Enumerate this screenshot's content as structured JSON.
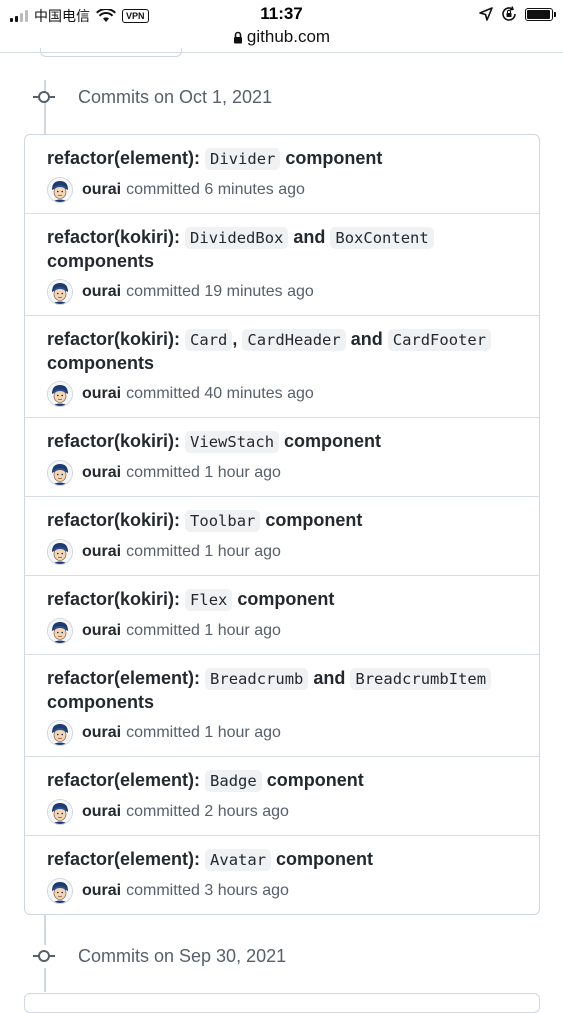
{
  "status_bar": {
    "carrier": "中国电信",
    "vpn": "VPN",
    "time": "11:37",
    "url": "github.com",
    "battery_level": 0.95
  },
  "groups": [
    {
      "title": "Commits on Oct 1, 2021"
    },
    {
      "title": "Commits on Sep 30, 2021"
    }
  ],
  "commits": [
    {
      "parts": [
        {
          "t": "text",
          "v": "refactor(element): "
        },
        {
          "t": "code",
          "v": "Divider"
        },
        {
          "t": "text",
          "v": " component"
        }
      ],
      "author": "ourai",
      "action": "committed",
      "time": "6 minutes ago"
    },
    {
      "parts": [
        {
          "t": "text",
          "v": "refactor(kokiri): "
        },
        {
          "t": "code",
          "v": "DividedBox"
        },
        {
          "t": "text",
          "v": " and "
        },
        {
          "t": "code",
          "v": "BoxContent"
        },
        {
          "t": "text",
          "v": " components"
        }
      ],
      "author": "ourai",
      "action": "committed",
      "time": "19 minutes ago"
    },
    {
      "parts": [
        {
          "t": "text",
          "v": "refactor(kokiri): "
        },
        {
          "t": "code",
          "v": "Card"
        },
        {
          "t": "text",
          "v": ", "
        },
        {
          "t": "code",
          "v": "CardHeader"
        },
        {
          "t": "text",
          "v": " and "
        },
        {
          "t": "code",
          "v": "CardFooter"
        },
        {
          "t": "text",
          "v": " components"
        }
      ],
      "author": "ourai",
      "action": "committed",
      "time": "40 minutes ago"
    },
    {
      "parts": [
        {
          "t": "text",
          "v": "refactor(kokiri): "
        },
        {
          "t": "code",
          "v": "ViewStach"
        },
        {
          "t": "text",
          "v": " component"
        }
      ],
      "author": "ourai",
      "action": "committed",
      "time": "1 hour ago"
    },
    {
      "parts": [
        {
          "t": "text",
          "v": "refactor(kokiri): "
        },
        {
          "t": "code",
          "v": "Toolbar"
        },
        {
          "t": "text",
          "v": " component"
        }
      ],
      "author": "ourai",
      "action": "committed",
      "time": "1 hour ago"
    },
    {
      "parts": [
        {
          "t": "text",
          "v": "refactor(kokiri): "
        },
        {
          "t": "code",
          "v": "Flex"
        },
        {
          "t": "text",
          "v": " component"
        }
      ],
      "author": "ourai",
      "action": "committed",
      "time": "1 hour ago"
    },
    {
      "parts": [
        {
          "t": "text",
          "v": "refactor(element): "
        },
        {
          "t": "code",
          "v": "Breadcrumb"
        },
        {
          "t": "text",
          "v": " and "
        },
        {
          "t": "code",
          "v": "BreadcrumbItem"
        },
        {
          "t": "text",
          "v": " components"
        }
      ],
      "author": "ourai",
      "action": "committed",
      "time": "1 hour ago"
    },
    {
      "parts": [
        {
          "t": "text",
          "v": "refactor(element): "
        },
        {
          "t": "code",
          "v": "Badge"
        },
        {
          "t": "text",
          "v": " component"
        }
      ],
      "author": "ourai",
      "action": "committed",
      "time": "2 hours ago"
    },
    {
      "parts": [
        {
          "t": "text",
          "v": "refactor(element): "
        },
        {
          "t": "code",
          "v": "Avatar"
        },
        {
          "t": "text",
          "v": " component"
        }
      ],
      "author": "ourai",
      "action": "committed",
      "time": "3 hours ago"
    }
  ],
  "icons": {
    "group_node": "git-commit-icon",
    "avatar": "user-avatar-icon",
    "wifi": "wifi-icon",
    "location": "location-arrow-icon",
    "lock_rotation": "orientation-lock-icon",
    "battery": "battery-icon",
    "url_lock": "lock-icon"
  },
  "colors": {
    "text": "#24292f",
    "muted": "#57606a",
    "border": "#d0d7de",
    "code_bg": "#eff1f3"
  }
}
